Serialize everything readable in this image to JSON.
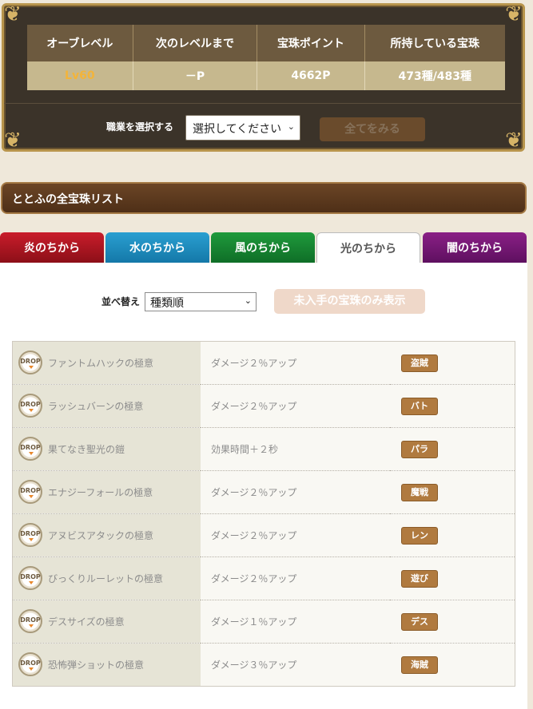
{
  "status": {
    "headers": [
      "オーブレベル",
      "次のレベルまで",
      "宝珠ポイント",
      "所持している宝珠"
    ],
    "values": [
      "Lv60",
      "－P",
      "4662P",
      "473種/483種"
    ]
  },
  "job_select": {
    "label": "職業を選択する",
    "value": "選択してください",
    "view_all_label": "全てをみる"
  },
  "section_title": "ととふの全宝珠リスト",
  "tabs": [
    {
      "label": "炎のちから"
    },
    {
      "label": "水のちから"
    },
    {
      "label": "風のちから"
    },
    {
      "label": "光のちから",
      "active": true
    },
    {
      "label": "闇のちから"
    }
  ],
  "sort": {
    "label": "並べ替え",
    "value": "種類順",
    "filter_button": "未入手の宝珠のみ表示"
  },
  "drop_icon_text": "DROP",
  "orbs": [
    {
      "name": "ファントムハックの極意",
      "effect": "ダメージ２％アップ",
      "job": "盗賊"
    },
    {
      "name": "ラッシュバーンの極意",
      "effect": "ダメージ２％アップ",
      "job": "バト"
    },
    {
      "name": "果てなき聖光の鎧",
      "effect": "効果時間＋２秒",
      "job": "パラ"
    },
    {
      "name": "エナジーフォールの極意",
      "effect": "ダメージ２％アップ",
      "job": "魔戦"
    },
    {
      "name": "アヌビスアタックの極意",
      "effect": "ダメージ２％アップ",
      "job": "レン"
    },
    {
      "name": "びっくりルーレットの極意",
      "effect": "ダメージ２％アップ",
      "job": "遊び"
    },
    {
      "name": "デスサイズの極意",
      "effect": "ダメージ１％アップ",
      "job": "デス"
    },
    {
      "name": "恐怖弾ショットの極意",
      "effect": "ダメージ３％アップ",
      "job": "海賊"
    }
  ],
  "colors": {
    "level_text": "#f3b43a",
    "badge": "#b07a3f",
    "tab_fire": "#c91d2b",
    "tab_water": "#2a9fd1",
    "tab_wind": "#1f9a3c",
    "tab_dark": "#8a1f86"
  }
}
